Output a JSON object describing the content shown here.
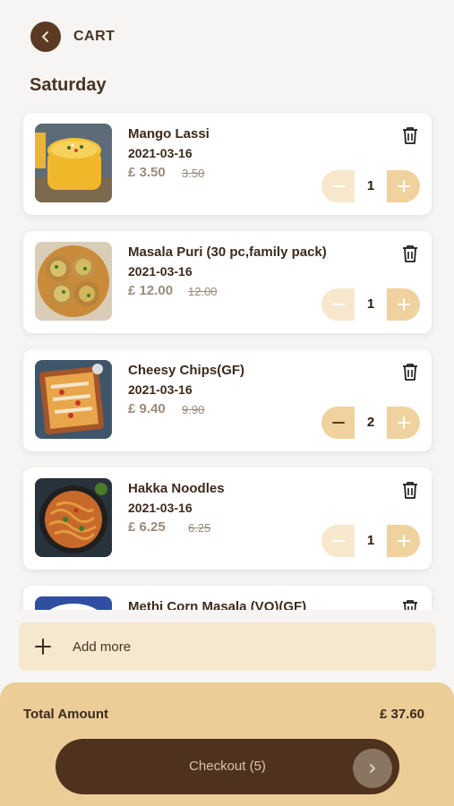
{
  "header": {
    "title": "CART",
    "back_icon": "chevron-left-icon"
  },
  "day_label": "Saturday",
  "items": [
    {
      "name": "Mango Lassi",
      "date": "2021-03-16",
      "price": "£ 3.50",
      "original_price": "3.50",
      "qty": "1",
      "minus_enabled": false
    },
    {
      "name": "Masala Puri (30 pc,family pack)",
      "date": "2021-03-16",
      "price": "£ 12.00",
      "original_price": "12.00",
      "qty": "1",
      "minus_enabled": false
    },
    {
      "name": "Cheesy Chips(GF)",
      "date": "2021-03-16",
      "price": "£ 9.40",
      "original_price": "9.90",
      "qty": "2",
      "minus_enabled": true
    },
    {
      "name": "Hakka Noodles",
      "date": "2021-03-16",
      "price": "£ 6.25",
      "original_price": "6.25",
      "qty": "1",
      "minus_enabled": false
    },
    {
      "name": "Methi Corn Masala (VO)(GF)",
      "date": "",
      "price": "",
      "original_price": "",
      "qty": "",
      "minus_enabled": false
    }
  ],
  "add_more": {
    "label": "Add more",
    "icon": "plus-icon"
  },
  "footer": {
    "total_label": "Total Amount",
    "total_value": "£ 37.60",
    "checkout_label": "Checkout (5)",
    "checkout_icon": "chevron-right-icon"
  },
  "colors": {
    "brown": "#4f321d",
    "stepper": "#f0d29f",
    "stepper_disabled": "#f7e8cd",
    "footer": "#eccd97",
    "add_more_bg": "#f6e7cf"
  }
}
